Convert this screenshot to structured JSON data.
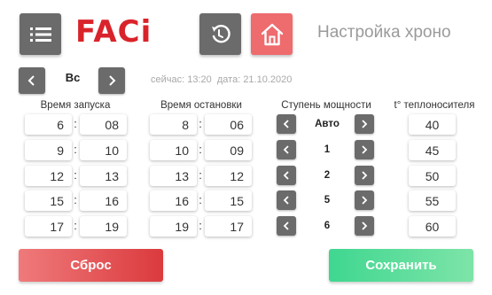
{
  "header": {
    "logo_text": "FACi",
    "title": "Настройка хроно",
    "menu_icon": "menu-icon",
    "undo_icon": "undo-icon",
    "home_icon": "home-icon",
    "home_color": "#ee6b6e"
  },
  "day": {
    "label": "Вс",
    "now_text": "сейчас: 13:20",
    "date_text": "дата: 21.10.2020"
  },
  "columns": {
    "start": "Время запуска",
    "stop": "Время остановки",
    "power": "Ступень мощности",
    "temp": "t° теплоносителя"
  },
  "rows": [
    {
      "start_h": "6",
      "start_m": "08",
      "stop_h": "8",
      "stop_m": "06",
      "power": "Авто",
      "temp": "40"
    },
    {
      "start_h": "9",
      "start_m": "10",
      "stop_h": "10",
      "stop_m": "09",
      "power": "1",
      "temp": "45"
    },
    {
      "start_h": "12",
      "start_m": "13",
      "stop_h": "13",
      "stop_m": "12",
      "power": "2",
      "temp": "50"
    },
    {
      "start_h": "15",
      "start_m": "16",
      "stop_h": "16",
      "stop_m": "15",
      "power": "5",
      "temp": "55"
    },
    {
      "start_h": "17",
      "start_m": "19",
      "stop_h": "19",
      "stop_m": "17",
      "power": "6",
      "temp": "60"
    }
  ],
  "separator": ":",
  "buttons": {
    "reset": "Сброс",
    "save": "Сохранить"
  },
  "colors": {
    "reset": "#e0474a",
    "save": "#4fdc95",
    "brand": "#d9232b"
  }
}
